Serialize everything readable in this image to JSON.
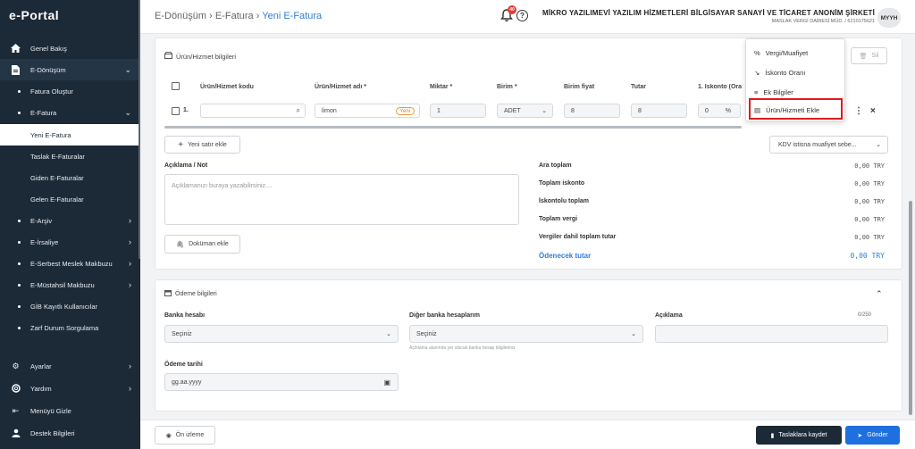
{
  "app": {
    "logo": "e-Portal"
  },
  "sidebar": {
    "items": [
      {
        "label": "Genel Bakış",
        "icon": "home-icon"
      },
      {
        "label": "E-Dönüşüm",
        "icon": "document-icon"
      },
      {
        "label": "Fatura Oluştur"
      },
      {
        "label": "E-Fatura"
      },
      {
        "label": "Yeni E-Fatura"
      },
      {
        "label": "Taslak E-Faturalar"
      },
      {
        "label": "Giden E-Faturalar"
      },
      {
        "label": "Gelen E-Faturalar"
      },
      {
        "label": "E-Arşiv"
      },
      {
        "label": "E-İrsaliye"
      },
      {
        "label": "E-Serbest Meslek Makbuzu"
      },
      {
        "label": "E-Müstahsil Makbuzu"
      },
      {
        "label": "GİB Kayıtlı Kullanıcılar"
      },
      {
        "label": "Zarf Durum Sorgulama"
      },
      {
        "label": "Ayarlar",
        "icon": "gear-icon"
      },
      {
        "label": "Yardım",
        "icon": "lifebuoy-icon"
      },
      {
        "label": "Menüyü Gizle",
        "icon": "collapse-icon"
      },
      {
        "label": "Destek Bilgileri",
        "icon": "user-icon"
      }
    ]
  },
  "header": {
    "breadcrumb": [
      "E-Dönüşüm",
      "E-Fatura",
      "Yeni E-Fatura"
    ],
    "notification_count": "40",
    "company_name": "MİKRO YAZILIMEVİ YAZILIM HİZMETLERİ BİLGİSAYAR SANAYİ VE TİCARET ANONİM ŞİRKETİ",
    "company_tax": "MASLAK VERGİ DAİRESİ MÜD. / 6210175621",
    "avatar": "MYYH"
  },
  "products": {
    "title": "Ürün/Hizmet bilgileri",
    "delete_label": "Sil",
    "columns": [
      "Ürün/Hizmet kodu",
      "Ürün/Hizmet adı *",
      "Miktar *",
      "Birim *",
      "Birim fiyat",
      "Tutar",
      "1. İskonto (Ora"
    ],
    "row": {
      "index": "1.",
      "code": "",
      "name": "limon",
      "name_badge": "Yeni",
      "quantity": "1",
      "unit": "ADET",
      "unit_price": "8",
      "amount": "8",
      "discount": "0",
      "discount_unit": "%"
    },
    "add_row_label": "Yeni satır ekle",
    "kdv_select": "KDV istisna muafiyet sebe..."
  },
  "menu": {
    "items": [
      "Vergi/Muafiyet",
      "İskonto Oranı",
      "Ek Bilgiler",
      "Ürün/Hizmeti Ekle"
    ]
  },
  "note": {
    "label": "Açıklama / Not",
    "placeholder": "Açıklamanızı buraya yazabilirsiniz....",
    "attach_label": "Doküman ekle"
  },
  "totals": [
    {
      "label": "Ara toplam",
      "value": "0,00 TRY"
    },
    {
      "label": "Toplam iskonto",
      "value": "0,00 TRY"
    },
    {
      "label": "İskontolu toplam",
      "value": "0,00 TRY"
    },
    {
      "label": "Toplam vergi",
      "value": "0,00 TRY"
    },
    {
      "label": "Vergiler dahil toplam tutar",
      "value": "0,00 TRY"
    }
  ],
  "payable": {
    "label": "Ödenecek tutar",
    "value": "0,00 TRY"
  },
  "payment": {
    "title": "Ödeme bilgileri",
    "bank_label": "Banka hesabı",
    "bank_value": "Seçiniz",
    "other_bank_label": "Diğer banka hesaplarım",
    "other_bank_value": "Seçiniz",
    "other_bank_hint": "Açıklama alanında yer alacak banka hesap bilgileriniz",
    "desc_label": "Açıklama",
    "desc_counter": "0/250",
    "date_label": "Ödeme tarihi",
    "date_value": "gg.aa.yyyy"
  },
  "footer": {
    "preview_label": "Ön izleme",
    "draft_label": "Taslaklara kaydet",
    "send_label": "Gönder"
  },
  "colors": {
    "sidebar": "#1c2a38",
    "accent": "#2f7ed8",
    "send": "#1e6fe0",
    "draft": "#1c2a38",
    "highlight": "#e0191b"
  }
}
